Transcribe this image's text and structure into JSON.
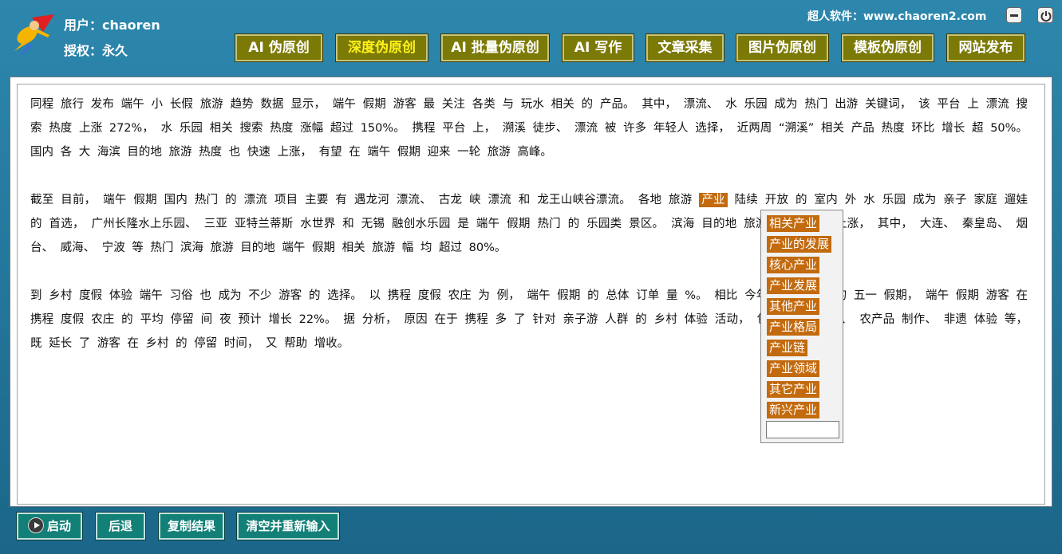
{
  "header": {
    "user_line": "用户：chaoren",
    "license_line": "授权：永久",
    "site_label": "超人软件：www.chaoren2.com"
  },
  "nav": {
    "items": [
      {
        "label": "AI 伪原创"
      },
      {
        "label": "深度伪原创"
      },
      {
        "label": "AI 批量伪原创"
      },
      {
        "label": "AI 写作"
      },
      {
        "label": "文章采集"
      },
      {
        "label": "图片伪原创"
      },
      {
        "label": "模板伪原创"
      },
      {
        "label": "网站发布"
      }
    ],
    "active_label": "深度伪原创"
  },
  "content": {
    "p1": "同程 旅行 发布 端午 小 长假 旅游 趋势 数据 显示， 端午 假期 游客 最 关注 各类 与 玩水 相关 的 产品。 其中， 漂流、 水 乐园 成为 热门 出游 关键词， 该 平台 上 漂流 搜索 热度 上涨 272%， 水 乐园 相关 搜索 热度 涨幅 超过 150%。 携程 平台 上， 溯溪 徒步、 漂流 被 许多 年轻人 选择， 近两周 “溯溪” 相关 产品 热度 环比 增长 超 50%。 国内 各 大 海滨 目的地 旅游 热度 也 快速 上涨， 有望 在 端午 假期 迎来 一轮 旅游 高峰。",
    "p2_before": "截至 目前， 端午 假期 国内 热门 的 漂流 项目 主要 有 遇龙河 漂流、 古龙 峡 漂流 和 龙王山峡谷漂流。 各地 旅游 ",
    "p2_highlight": "产业",
    "p2_after": " 陆续 开放 的 室内 外 水 乐园 成为 亲子 家庭 遛娃 的 首选， 广州长隆水上乐园、 三亚 亚特兰蒂斯 水世界 和 无锡 融创水乐园 是 端午 假期 热门 的 乐园类 景区。 滨海 目的地 旅游 热度 普遍 上涨， 其中， 大连、 秦皇岛、 烟台、 威海、 宁波 等 热门 滨海 旅游 目的地 端午 假期 相关 旅游 幅 均 超过 80%。",
    "p3": "到 乡村 度假 体验 端午 习俗 也 成为 不少 游客 的 选择。 以 携程 度假 农庄 为 例， 端午 假期 的 总体 订单 量 %。 相比 今年 火爆 异常 的 五一 假期， 端午 假期 游客 在 携程 度假 农庄 的 平均 停留 间 夜 预计 增长 22%。 据 分析， 原因 在于 携程 多 了 针对 亲子游 人群 的 乡村 体验 活动， 包括 农事 体验、 农产品 制作、 非遗 体验 等， 既 延长 了 游客 在 乡村 的 停留 时间， 又 帮助 增收。"
  },
  "dropdown": {
    "options": [
      "相关产业",
      "产业的发展",
      "核心产业",
      "产业发展",
      "其他产业",
      "产业格局",
      "产业链",
      "产业领域",
      "其它产业",
      "新兴产业"
    ],
    "input_value": ""
  },
  "footer": {
    "start": "启动",
    "back": "后退",
    "copy": "复制结果",
    "clear": "清空并重新输入"
  },
  "colors": {
    "nav_button": "#7c7a06",
    "nav_active_text": "#fff21a",
    "highlight": "#c36a0e",
    "footer_button": "#138078",
    "frame": "#1d6a8e"
  }
}
